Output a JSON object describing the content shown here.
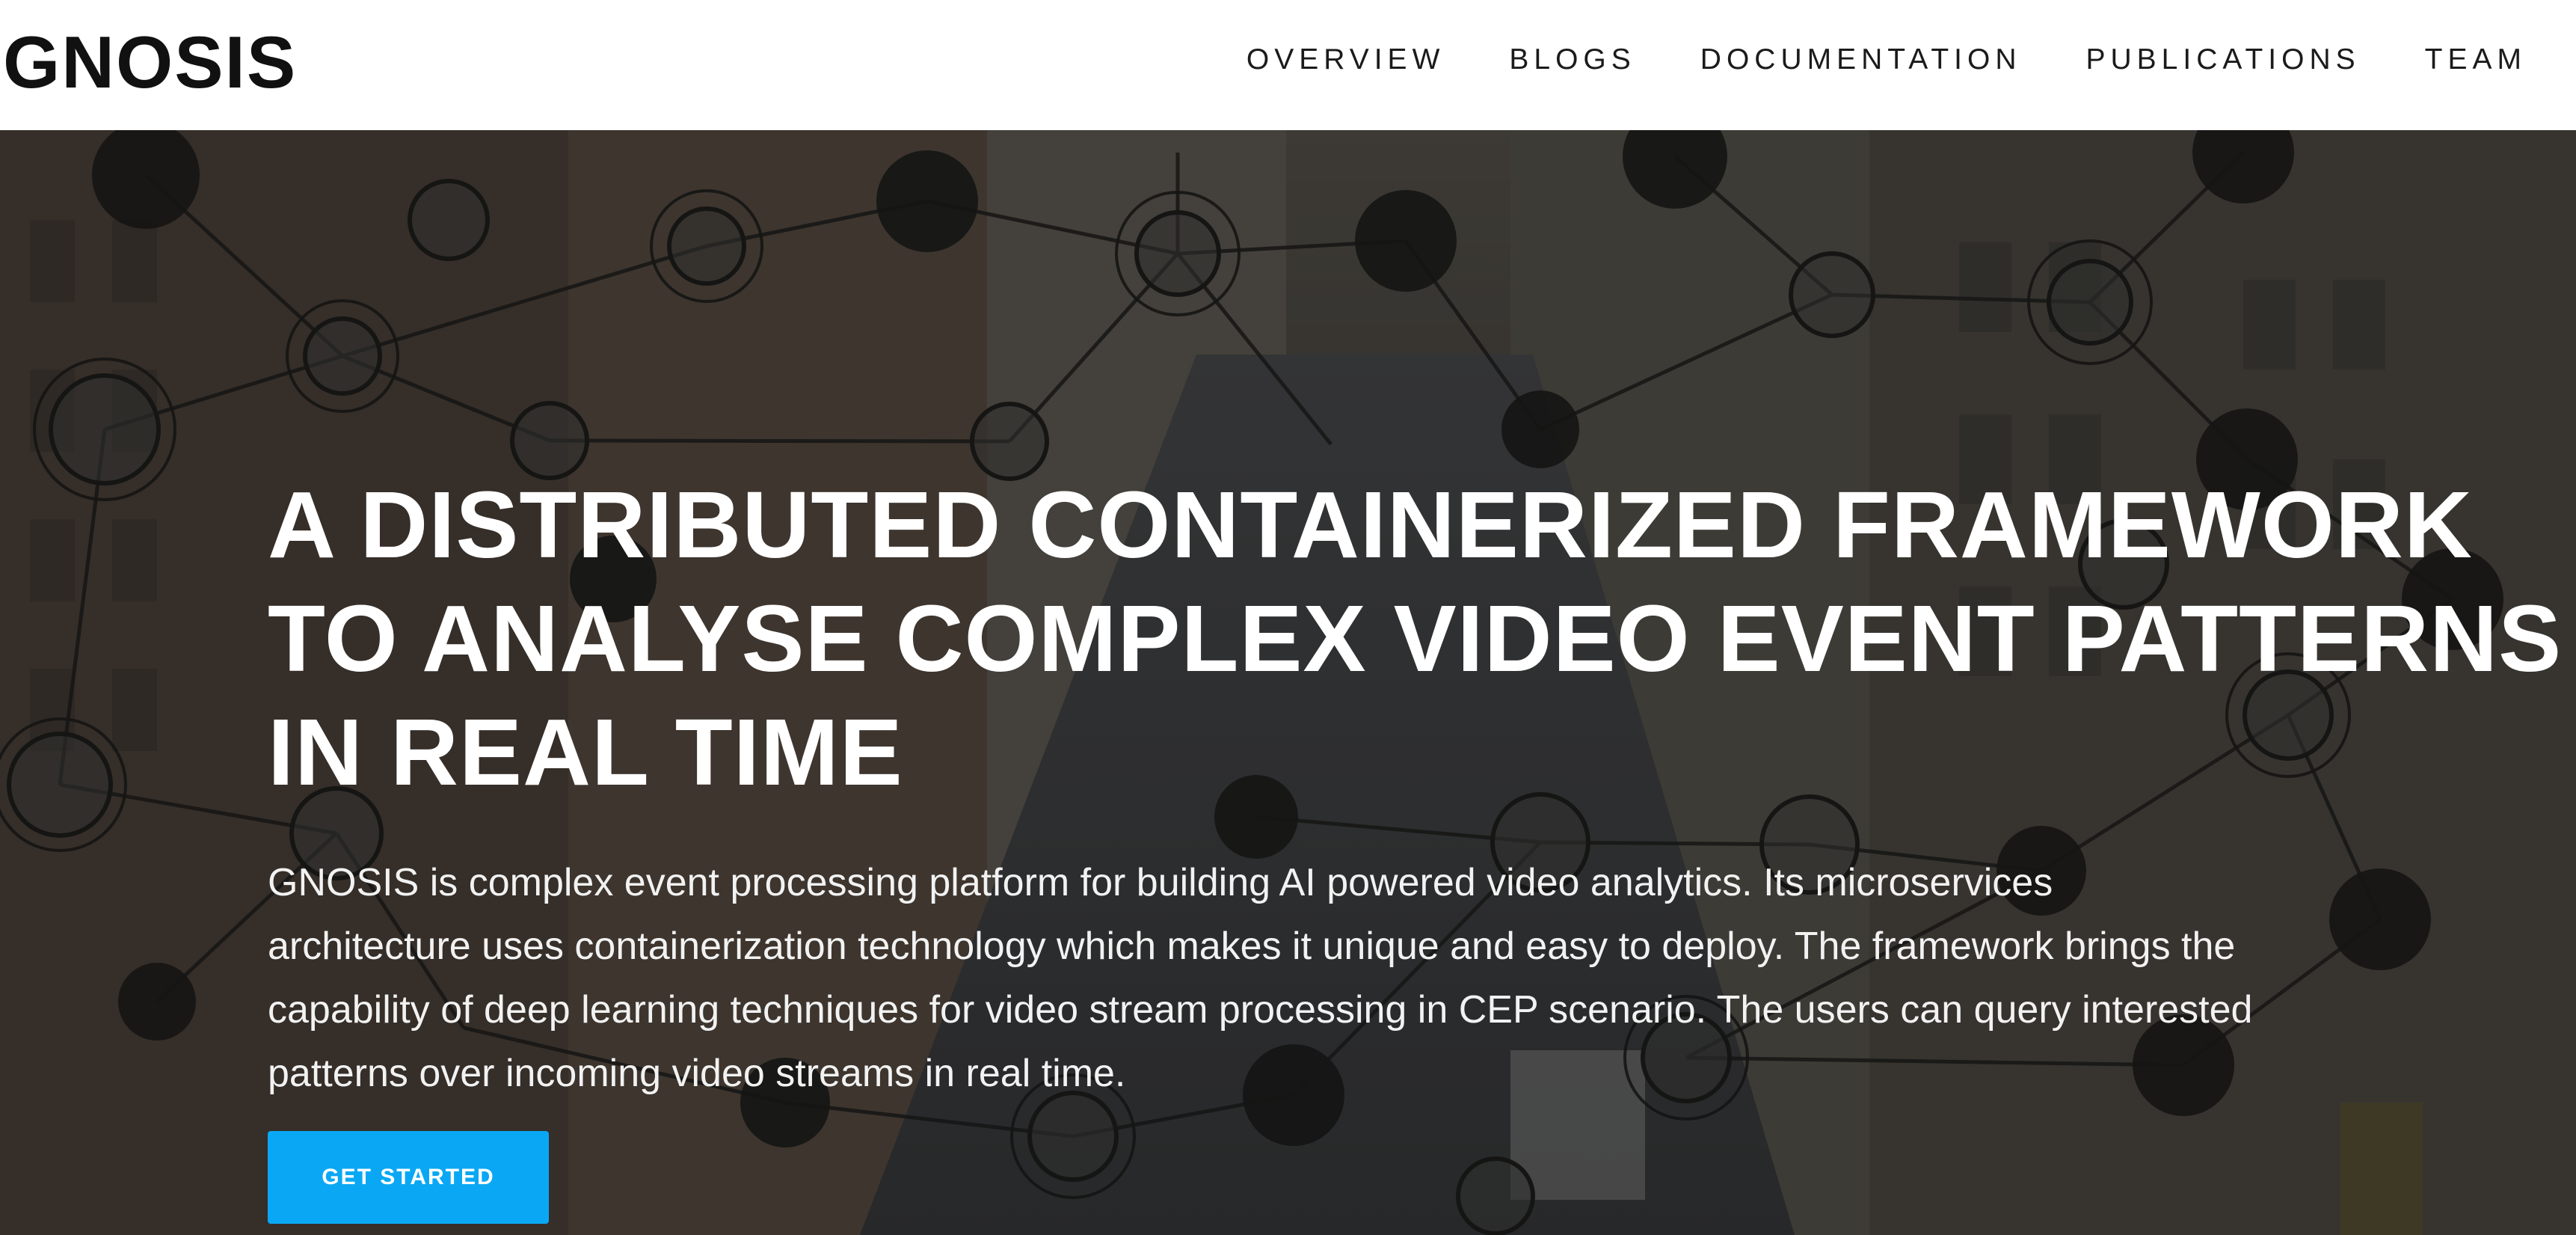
{
  "brand": {
    "name": "GNOSIS"
  },
  "nav": {
    "items": [
      {
        "label": "OVERVIEW"
      },
      {
        "label": "BLOGS"
      },
      {
        "label": "DOCUMENTATION"
      },
      {
        "label": "PUBLICATIONS"
      },
      {
        "label": "TEAM"
      }
    ]
  },
  "hero": {
    "headline_lines": [
      "A DISTRIBUTED CONTAINERIZED FRAMEWORK",
      "TO ANALYSE COMPLEX VIDEO EVENT PATTERNS",
      "IN REAL TIME"
    ],
    "description": "GNOSIS is complex event processing platform for building AI powered video analytics. Its microservices architecture uses containerization technology which makes it unique and easy to deploy. The framework brings the capability of deep learning techniques for video stream processing in CEP scenario. The users can query interested patterns over incoming video streams in real time.",
    "cta_label": "GET STARTED",
    "background_icon": "network-graph-over-city-street-photo"
  },
  "colors": {
    "accent": "#0aa8f4",
    "nav_background": "#ffffff",
    "hero_overlay": "#181716",
    "text_on_dark": "#ffffff"
  }
}
